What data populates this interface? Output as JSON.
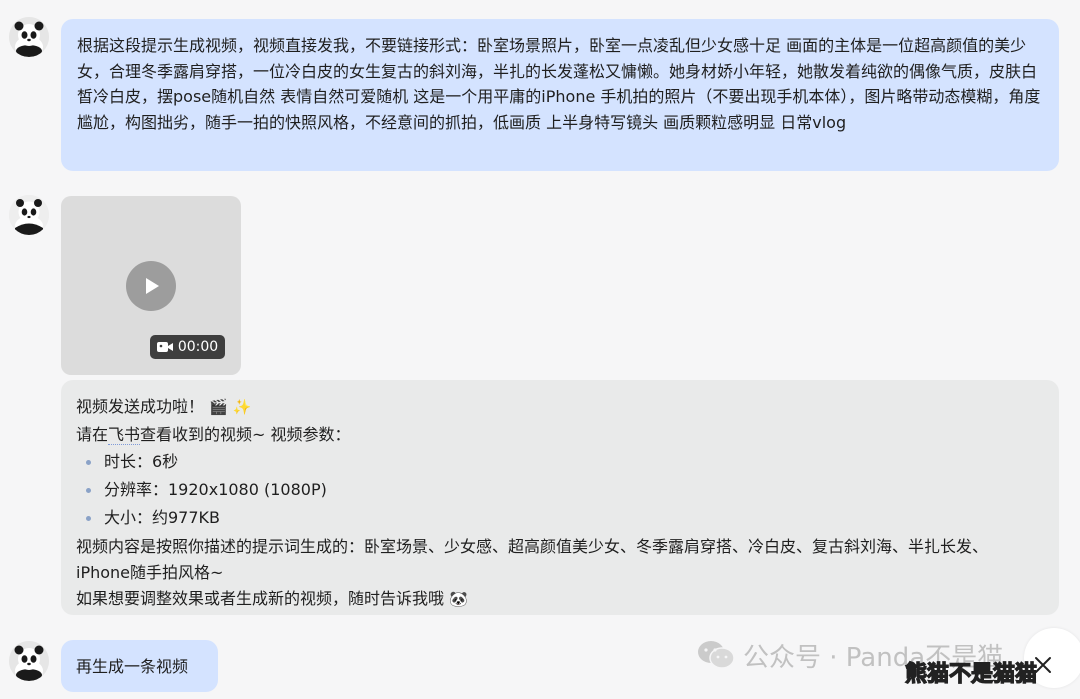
{
  "messages": {
    "msg1": {
      "role": "user",
      "text": "根据这段提示生成视频，视频直接发我，不要链接形式：卧室场景照片，卧室一点凌乱但少女感十足 画面的主体是一位超高颜值的美少女，合理冬季露肩穿搭，一位冷白皮的女生复古的斜刘海，半扎的长发蓬松又慵懒。她身材娇小年轻，她散发着纯欲的偶像气质，皮肤白皙冷白皮，摆pose随机自然 表情自然可爱随机 这是一个用平庸的iPhone 手机拍的照片（不要出现手机本体），图片略带动态模糊，角度尴尬，构图拙劣，随手一拍的快照风格，不经意间的抓拍，低画质 上半身特写镜头 画质颗粒感明显 日常vlog"
    },
    "video": {
      "duration": "00:00",
      "play_icon": "play-icon",
      "camera_icon": "video-camera-icon"
    },
    "msg2": {
      "role": "bot",
      "line1": "视频发送成功啦！",
      "line1_emoji": "🎬 ✨",
      "line2_pre": "请在",
      "line2_link": "飞书",
      "line2_post": "查看收到的视频~ 视频参数：",
      "params": [
        "时长：6秒",
        "分辨率：1920x1080 (1080P)",
        "大小：约977KB"
      ],
      "desc": "视频内容是按照你描述的提示词生成的：卧室场景、少女感、超高颜值美少女、冬季露肩穿搭、冷白皮、复古斜刘海、半扎长发、iPhone随手拍风格~",
      "closing": "如果想要调整效果或者生成新的视频，随时告诉我哦",
      "closing_emoji": "🐼"
    },
    "msg3": {
      "role": "user",
      "text": "再生成一条视频"
    }
  },
  "watermark": {
    "text": "公众号 · Panda不是猫",
    "brand": "熊猫不是猫猫",
    "icon": "wechat-icon"
  },
  "controls": {
    "close_icon": "close-icon"
  },
  "colors": {
    "user_bubble": "#d4e3ff",
    "bot_bubble": "#e9eaea",
    "background": "#f6f6f7"
  }
}
